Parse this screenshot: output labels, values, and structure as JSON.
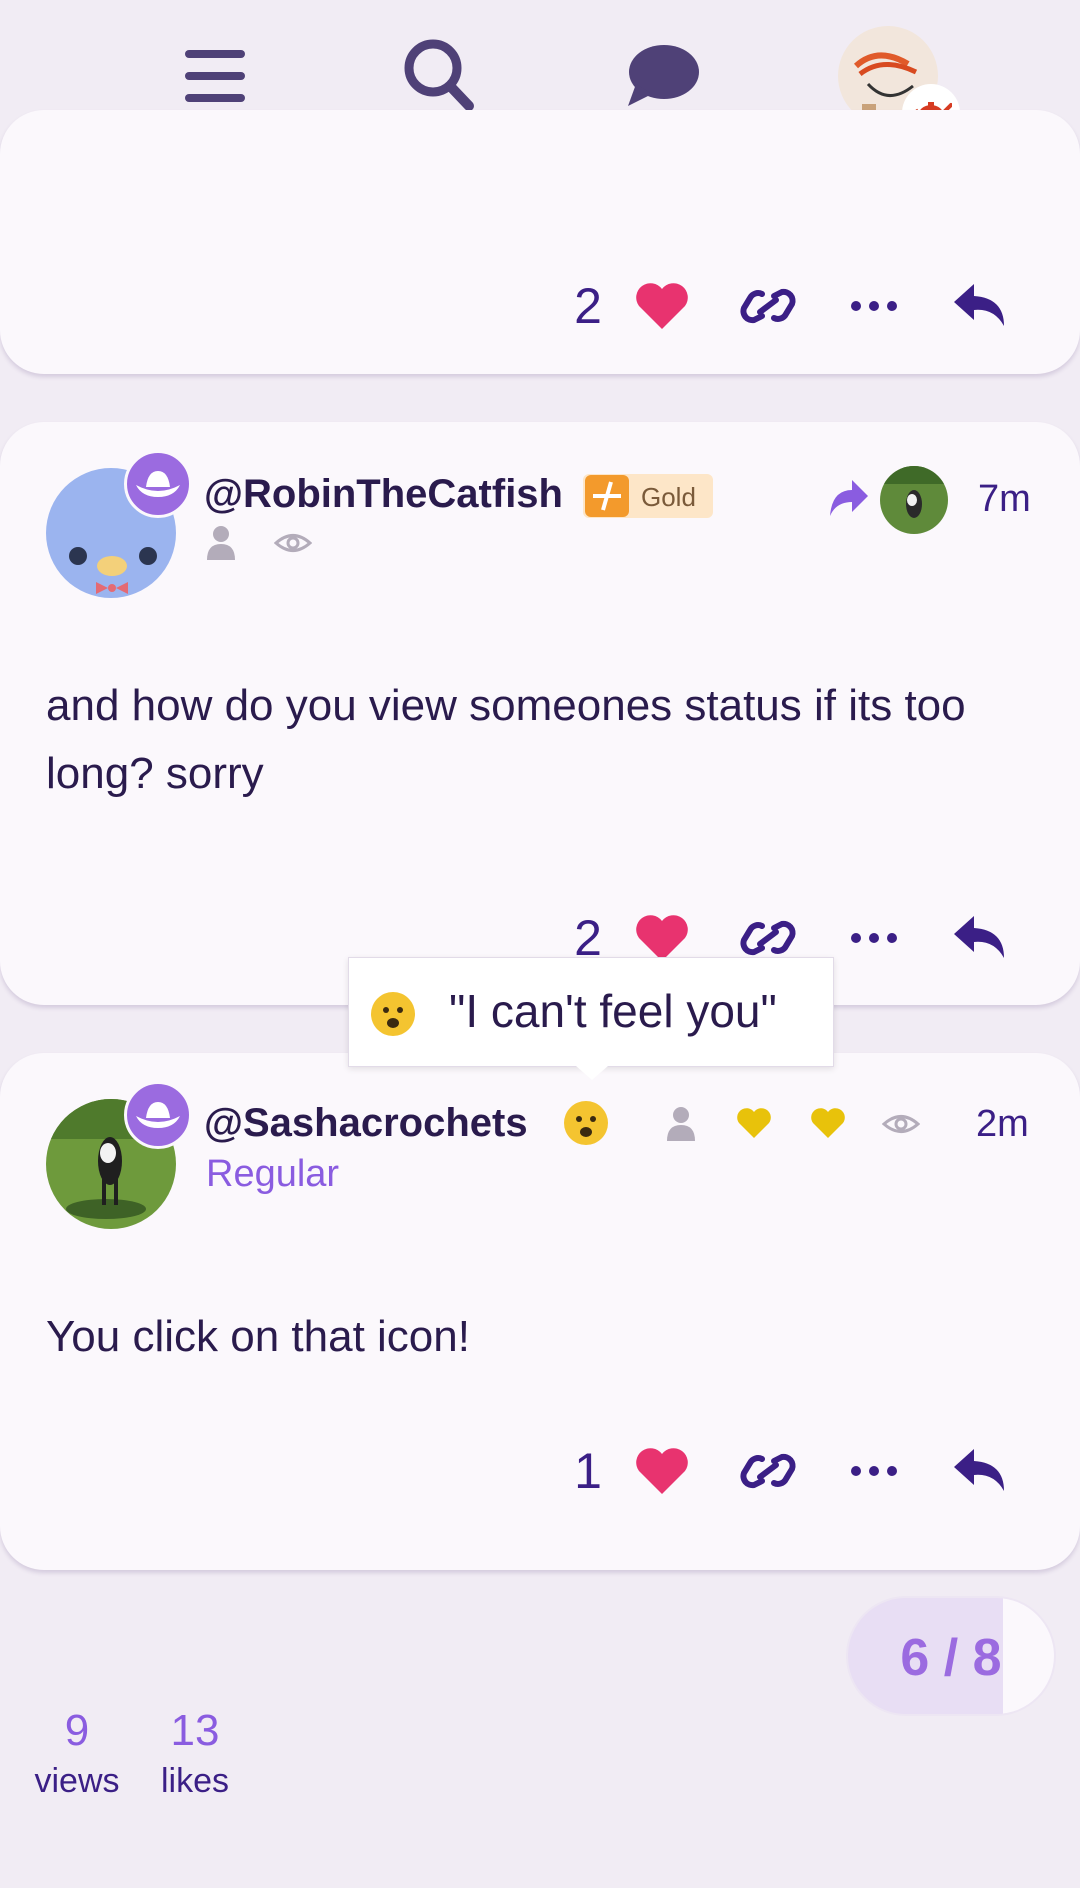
{
  "top_nav": {
    "menu_icon": "hamburger-menu-icon",
    "search_icon": "search-icon",
    "chat_icon": "chat-bubble-icon",
    "user_avatar": "user-avatar",
    "status_icon": "teapot-icon"
  },
  "posts": [
    {
      "like_count": "2"
    },
    {
      "username": "@RobinTheCatfish",
      "flair_label": "Gold",
      "time": "7m",
      "body": "and how do you view someones status if its too long? sorry",
      "like_count": "2"
    },
    {
      "username": "@Sashacrochets",
      "title": "Regular",
      "time": "2m",
      "body": "You click on that icon!",
      "like_count": "1"
    }
  ],
  "status_tooltip": {
    "text": "\"I can't feel you\""
  },
  "progress": {
    "current": 6,
    "total": 8,
    "label": "6 / 8"
  },
  "stats": {
    "views_value": "9",
    "views_label": "views",
    "likes_value": "13",
    "likes_label": "likes"
  },
  "colors": {
    "accent": "#3b1f86",
    "heart": "#e8336f",
    "purple": "#9b6be0",
    "gold_heart": "#e8c20b",
    "background": "#f1ecf4",
    "card": "#fbf8fc"
  }
}
